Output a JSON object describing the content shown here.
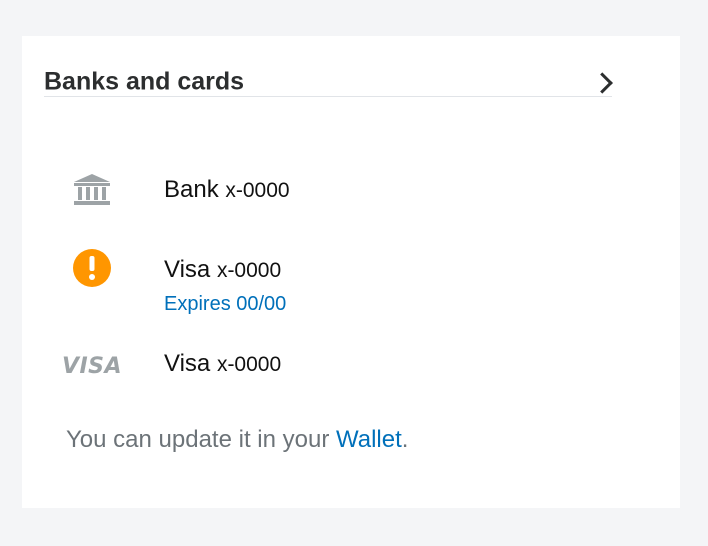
{
  "header": {
    "title": "Banks and cards",
    "chevron_icon": "chevron-right-icon"
  },
  "accounts": [
    {
      "icon": "bank-icon",
      "name": "Bank",
      "mask": "x-0000"
    },
    {
      "icon": "warning-icon",
      "name": "Visa",
      "mask": "x-0000",
      "status": "Expires 00/00"
    },
    {
      "icon": "visa-logo",
      "logo_text": "VISA",
      "name": "Visa",
      "mask": "x-0000"
    }
  ],
  "footer": {
    "text_before": "You can update it in your ",
    "link_text": "Wallet",
    "text_after": "."
  },
  "colors": {
    "link": "#0070ba",
    "warning": "#ff9600",
    "icon_gray": "#9da3a6",
    "text_dark": "#2c2e2f",
    "text_muted": "#6c7378"
  }
}
